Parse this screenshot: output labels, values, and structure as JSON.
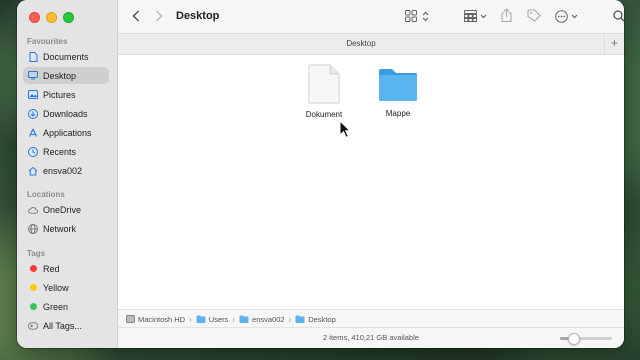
{
  "window": {
    "title": "Desktop",
    "tab_label": "Desktop"
  },
  "sidebar": {
    "favourites_title": "Favourites",
    "favourites": [
      {
        "label": "Documents",
        "icon": "document-icon"
      },
      {
        "label": "Desktop",
        "icon": "desktop-icon",
        "selected": true
      },
      {
        "label": "Pictures",
        "icon": "pictures-icon"
      },
      {
        "label": "Downloads",
        "icon": "downloads-icon"
      },
      {
        "label": "Applications",
        "icon": "applications-icon"
      },
      {
        "label": "Recents",
        "icon": "recents-icon"
      },
      {
        "label": "ensva002",
        "icon": "home-icon"
      }
    ],
    "locations_title": "Locations",
    "locations": [
      {
        "label": "OneDrive",
        "icon": "cloud-icon"
      },
      {
        "label": "Network",
        "icon": "globe-icon"
      }
    ],
    "tags_title": "Tags",
    "tags": [
      {
        "label": "Red",
        "color": "#ff3b30"
      },
      {
        "label": "Yellow",
        "color": "#ffcc00"
      },
      {
        "label": "Green",
        "color": "#34c759"
      },
      {
        "label": "All Tags...",
        "icon": "all-tags-icon"
      }
    ]
  },
  "files": [
    {
      "label": "Dokument",
      "icon": "generic-file-icon"
    },
    {
      "label": "Mappe",
      "icon": "folder-icon"
    }
  ],
  "pathbar": [
    {
      "label": "Macintosh HD",
      "icon": "disk-icon"
    },
    {
      "label": "Users",
      "icon": "folder-icon"
    },
    {
      "label": "ensva002",
      "icon": "folder-icon"
    },
    {
      "label": "Desktop",
      "icon": "folder-icon"
    }
  ],
  "status": {
    "text": "2 items, 410,21 GB available",
    "icon_size_level": 0.2
  },
  "colors": {
    "accent": "#0a84ff",
    "folder": "#5ab4f0"
  }
}
